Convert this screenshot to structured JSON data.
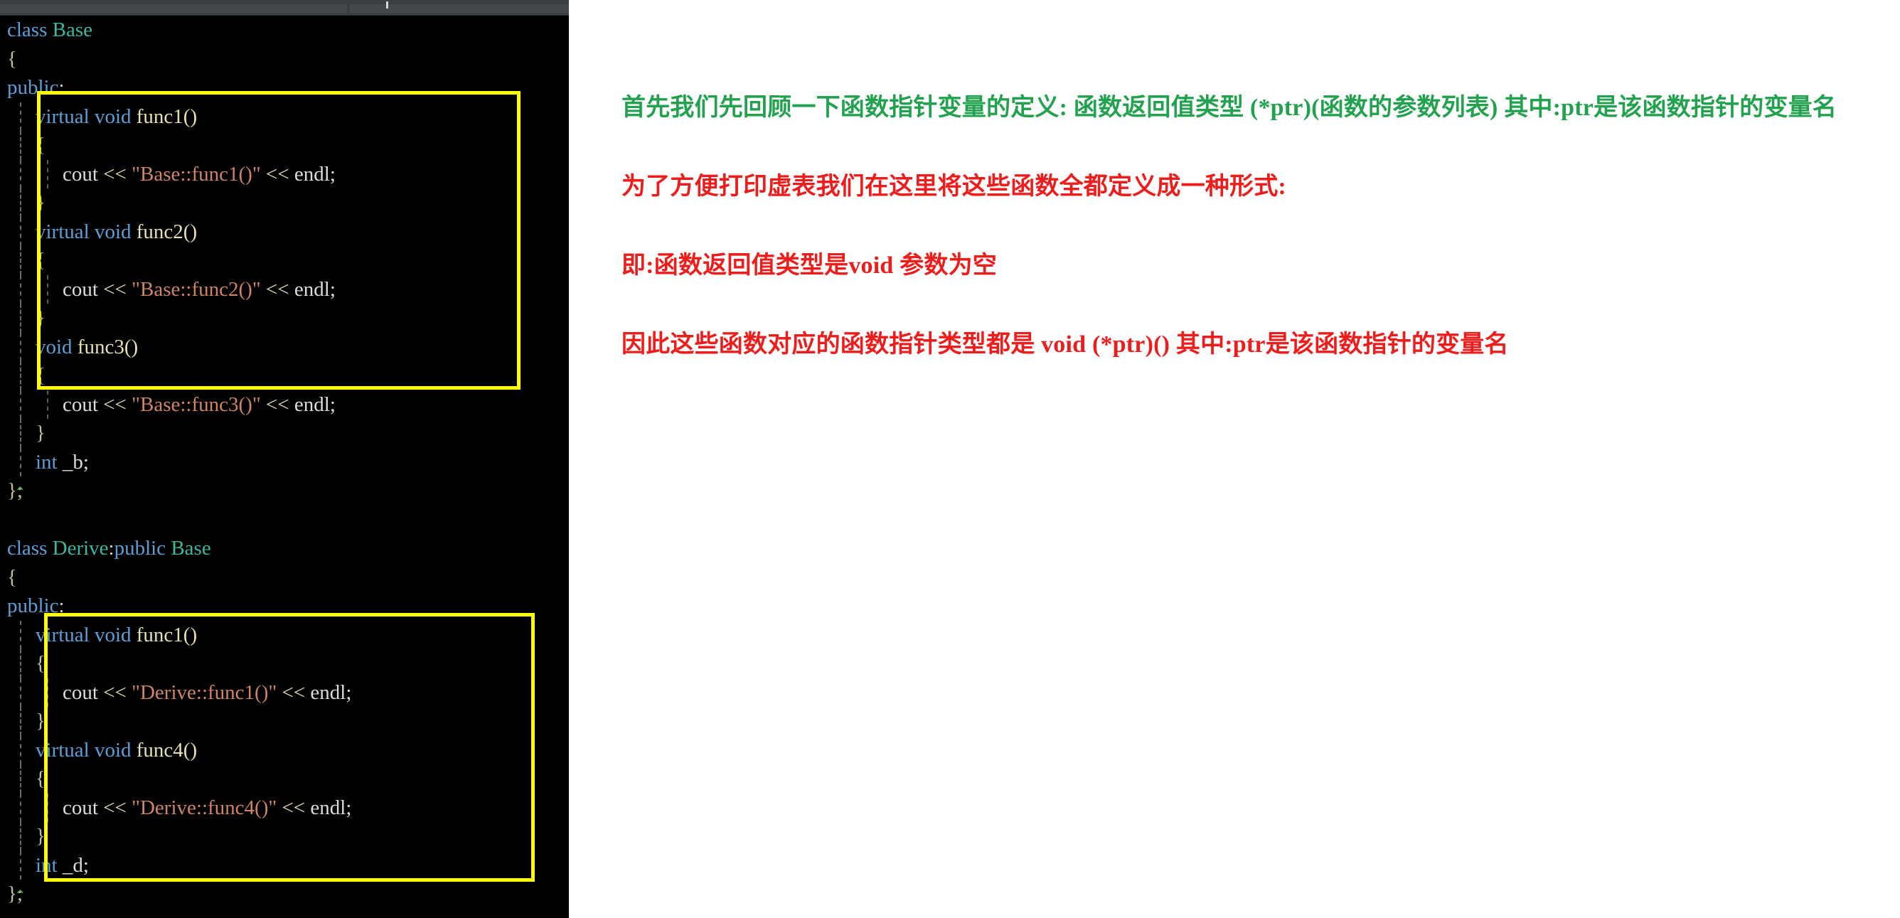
{
  "editor": {
    "toolbar": {
      "caret_mark": ""
    },
    "language": "cpp",
    "code_lines": [
      {
        "indent": 0,
        "guides": 0,
        "tokens": [
          {
            "t": "class ",
            "c": "kw"
          },
          {
            "t": "Base",
            "c": "type"
          }
        ]
      },
      {
        "indent": 0,
        "guides": 0,
        "tokens": [
          {
            "t": "{",
            "c": "brace"
          }
        ]
      },
      {
        "indent": 0,
        "guides": 0,
        "tokens": [
          {
            "t": "public",
            "c": "kw"
          },
          {
            "t": ":",
            "c": "punct"
          }
        ]
      },
      {
        "indent": 1,
        "guides": 1,
        "tokens": [
          {
            "t": "virtual ",
            "c": "kw"
          },
          {
            "t": "void ",
            "c": "kw"
          },
          {
            "t": "func1()",
            "c": "fn"
          }
        ]
      },
      {
        "indent": 1,
        "guides": 1,
        "tokens": [
          {
            "t": "{",
            "c": "brace"
          }
        ]
      },
      {
        "indent": 2,
        "guides": 2,
        "tokens": [
          {
            "t": "cout ",
            "c": "plain"
          },
          {
            "t": "<< ",
            "c": "op"
          },
          {
            "t": "\"Base::func1()\"",
            "c": "str"
          },
          {
            "t": " << ",
            "c": "op"
          },
          {
            "t": "endl;",
            "c": "plain"
          }
        ]
      },
      {
        "indent": 1,
        "guides": 1,
        "tokens": [
          {
            "t": "}",
            "c": "brace"
          }
        ]
      },
      {
        "indent": 1,
        "guides": 1,
        "tokens": [
          {
            "t": "virtual ",
            "c": "kw"
          },
          {
            "t": "void ",
            "c": "kw"
          },
          {
            "t": "func2()",
            "c": "fn"
          }
        ]
      },
      {
        "indent": 1,
        "guides": 1,
        "tokens": [
          {
            "t": "{",
            "c": "brace"
          }
        ]
      },
      {
        "indent": 2,
        "guides": 2,
        "tokens": [
          {
            "t": "cout ",
            "c": "plain"
          },
          {
            "t": "<< ",
            "c": "op"
          },
          {
            "t": "\"Base::func2()\"",
            "c": "str"
          },
          {
            "t": " << ",
            "c": "op"
          },
          {
            "t": "endl;",
            "c": "plain"
          }
        ]
      },
      {
        "indent": 1,
        "guides": 1,
        "tokens": [
          {
            "t": "}",
            "c": "brace"
          }
        ]
      },
      {
        "indent": 1,
        "guides": 1,
        "tokens": [
          {
            "t": "void ",
            "c": "kw"
          },
          {
            "t": "func3()",
            "c": "fn"
          }
        ]
      },
      {
        "indent": 1,
        "guides": 1,
        "tokens": [
          {
            "t": "{",
            "c": "brace"
          }
        ]
      },
      {
        "indent": 2,
        "guides": 2,
        "tokens": [
          {
            "t": "cout ",
            "c": "plain"
          },
          {
            "t": "<< ",
            "c": "op"
          },
          {
            "t": "\"Base::func3()\"",
            "c": "str"
          },
          {
            "t": " << ",
            "c": "op"
          },
          {
            "t": "endl;",
            "c": "plain"
          }
        ]
      },
      {
        "indent": 1,
        "guides": 1,
        "tokens": [
          {
            "t": "}",
            "c": "brace"
          }
        ]
      },
      {
        "indent": 1,
        "guides": 1,
        "tokens": [
          {
            "t": "int ",
            "c": "kw"
          },
          {
            "t": "_b;",
            "c": "plain"
          }
        ]
      },
      {
        "indent": 0,
        "guides": 0,
        "fold": true,
        "tokens": [
          {
            "t": "};",
            "c": "brace"
          }
        ]
      },
      {
        "indent": 0,
        "guides": 0,
        "tokens": [
          {
            "t": "",
            "c": "plain"
          }
        ]
      },
      {
        "indent": 0,
        "guides": 0,
        "tokens": [
          {
            "t": "class ",
            "c": "kw"
          },
          {
            "t": "Derive",
            "c": "type"
          },
          {
            "t": ":",
            "c": "punct"
          },
          {
            "t": "public ",
            "c": "kw"
          },
          {
            "t": "Base",
            "c": "type"
          }
        ]
      },
      {
        "indent": 0,
        "guides": 0,
        "tokens": [
          {
            "t": "{",
            "c": "brace"
          }
        ]
      },
      {
        "indent": 0,
        "guides": 0,
        "tokens": [
          {
            "t": "public",
            "c": "kw"
          },
          {
            "t": ":",
            "c": "punct"
          }
        ]
      },
      {
        "indent": 1,
        "guides": 1,
        "tokens": [
          {
            "t": "virtual ",
            "c": "kw"
          },
          {
            "t": "void ",
            "c": "kw"
          },
          {
            "t": "func1()",
            "c": "fn"
          }
        ]
      },
      {
        "indent": 1,
        "guides": 1,
        "tokens": [
          {
            "t": "{",
            "c": "brace"
          }
        ]
      },
      {
        "indent": 2,
        "guides": 2,
        "tokens": [
          {
            "t": "cout ",
            "c": "plain"
          },
          {
            "t": "<< ",
            "c": "op"
          },
          {
            "t": "\"Derive::func1()\"",
            "c": "str"
          },
          {
            "t": " << ",
            "c": "op"
          },
          {
            "t": "endl;",
            "c": "plain"
          }
        ]
      },
      {
        "indent": 1,
        "guides": 1,
        "tokens": [
          {
            "t": "}",
            "c": "brace"
          }
        ]
      },
      {
        "indent": 1,
        "guides": 1,
        "tokens": [
          {
            "t": "virtual ",
            "c": "kw"
          },
          {
            "t": "void ",
            "c": "kw"
          },
          {
            "t": "func4()",
            "c": "fn"
          }
        ]
      },
      {
        "indent": 1,
        "guides": 1,
        "tokens": [
          {
            "t": "{",
            "c": "brace"
          }
        ]
      },
      {
        "indent": 2,
        "guides": 2,
        "tokens": [
          {
            "t": "cout ",
            "c": "plain"
          },
          {
            "t": "<< ",
            "c": "op"
          },
          {
            "t": "\"Derive::func4()\"",
            "c": "str"
          },
          {
            "t": " << ",
            "c": "op"
          },
          {
            "t": "endl;",
            "c": "plain"
          }
        ]
      },
      {
        "indent": 1,
        "guides": 1,
        "tokens": [
          {
            "t": "}",
            "c": "brace"
          }
        ]
      },
      {
        "indent": 1,
        "guides": 1,
        "tokens": [
          {
            "t": "int ",
            "c": "kw"
          },
          {
            "t": "_d;",
            "c": "plain"
          }
        ]
      },
      {
        "indent": 0,
        "guides": 0,
        "fold": true,
        "tokens": [
          {
            "t": "};",
            "c": "brace"
          }
        ]
      }
    ],
    "highlight_boxes": [
      {
        "name": "base-virtual-functions-highlight",
        "color": "#ffff00"
      },
      {
        "name": "derive-virtual-functions-highlight",
        "color": "#ffff00"
      }
    ]
  },
  "notes": {
    "lines": [
      {
        "color": "#22a14e",
        "text": "首先我们先回顾一下函数指针变量的定义: 函数返回值类型 (*ptr)(函数的参数列表)  其中:ptr是该函数指针的变量名"
      },
      {
        "color": "#ef1c1c",
        "text": "为了方便打印虚表我们在这里将这些函数全都定义成一种形式:"
      },
      {
        "color": "#ef1c1c",
        "text": "即:函数返回值类型是void 参数为空"
      },
      {
        "color": "#ef1c1c",
        "text": "因此这些函数对应的函数指针类型都是 void (*ptr)()   其中:ptr是该函数指针的变量名"
      }
    ]
  },
  "colors": {
    "editor_background": "#000000",
    "toolbar_background": "#3c3f41",
    "highlight_border": "#ffff00",
    "keyword": "#5c9fd6",
    "class_name": "#3cb7a0",
    "function_name": "#e8e0b0",
    "string_literal": "#d08462",
    "plain_text": "#dcdcdc",
    "notes_background": "#ffffff",
    "note_green": "#22a14e",
    "note_red": "#ef1c1c"
  }
}
